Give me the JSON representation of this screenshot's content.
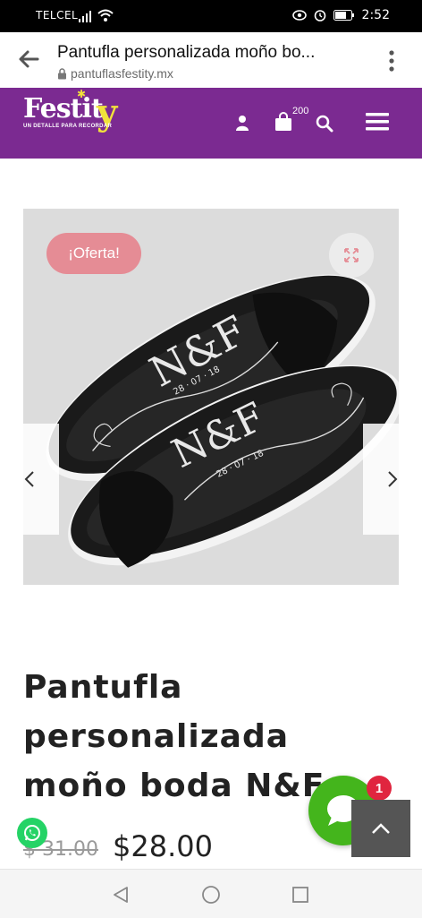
{
  "status_bar": {
    "carrier": "TELCEL",
    "time": "2:52"
  },
  "browser": {
    "page_title": "Pantufla personalizada moño bo...",
    "url": "pantuflasfestity.mx"
  },
  "header": {
    "logo_text": "Festit",
    "logo_y": "y",
    "logo_tagline": "UN DETALLE PARA RECORDAR",
    "cart_count": "200"
  },
  "product": {
    "badge": "¡Oferta!",
    "title": "Pantufla personalizada moño boda N&F",
    "old_price": "$ 31.00",
    "price": "$28.00",
    "monogram": "N&F",
    "date": "28 · 07 · 18"
  },
  "chat_badge_count": "1",
  "colors": {
    "header_bg": "#7b2a91",
    "badge_bg": "#e58c95",
    "chat_bg": "#44b51c",
    "logo_y": "#f1e23b"
  }
}
